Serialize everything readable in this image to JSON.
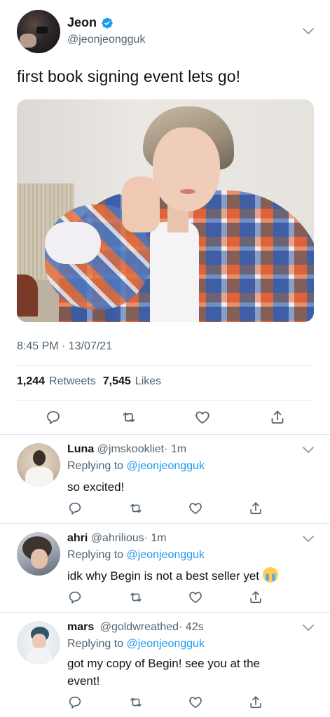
{
  "tweet": {
    "author_name": "Jeon",
    "author_handle": "@jeonjeongguk",
    "text": "first book signing event lets go!",
    "timestamp": "8:45 PM · 13/07/21",
    "retweets_count": "1,244",
    "retweets_label": "Retweets",
    "likes_count": "7,545",
    "likes_label": "Likes"
  },
  "replies": [
    {
      "name": "Luna",
      "handle": "@jmskookliet",
      "age": "· 1m",
      "replying_prefix": "Replying to",
      "replying_to": "@jeonjeongguk",
      "text": "so excited!"
    },
    {
      "name": "ahri",
      "handle": "@ahrilious",
      "age": "· 1m",
      "replying_prefix": "Replying to",
      "replying_to": "@jeonjeongguk",
      "text": "idk why Begin is not a best seller yet"
    },
    {
      "name": "mars",
      "handle": "@goldwreathed",
      "age": "· 42s",
      "replying_prefix": "Replying to",
      "replying_to": "@jeonjeongguk",
      "text": "got my copy of Begin! see you at the event!"
    }
  ],
  "colors": {
    "accent": "#1d9bf0",
    "text_primary": "#0f1419",
    "text_secondary": "#536471",
    "divider": "#e1e6ea"
  },
  "icons": [
    "verified-badge-icon",
    "chevron-down-icon",
    "reply-icon",
    "retweet-icon",
    "like-icon",
    "share-icon",
    "loudly-crying-face-emoji"
  ]
}
